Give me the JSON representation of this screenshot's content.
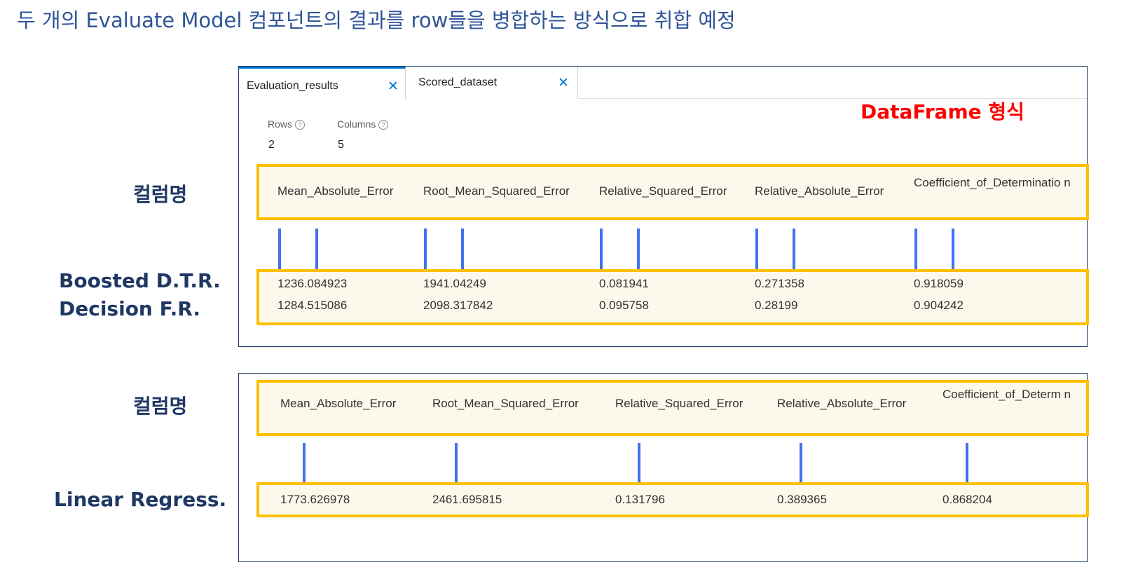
{
  "slide_title": "두 개의 Evaluate Model 컴포넌트의 결과를 row들을 병합하는 방식으로 취합 예정",
  "panel1": {
    "tabs": [
      {
        "label": "Evaluation_results",
        "close": "✕"
      },
      {
        "label": "Scored_dataset",
        "close": "✕"
      }
    ],
    "note": "DataFrame 형식",
    "rows_label": "Rows",
    "rows_value": "2",
    "columns_label": "Columns",
    "columns_value": "5",
    "help": "?",
    "columns": [
      "Mean_Absolute_Error",
      "Root_Mean_Squared_Error",
      "Relative_Squared_Error",
      "Relative_Absolute_Error",
      "Coefficient_of_Determinatio n"
    ],
    "rows": [
      [
        "1236.084923",
        "1941.04249",
        "0.081941",
        "0.271358",
        "0.918059"
      ],
      [
        "1284.515086",
        "2098.317842",
        "0.095758",
        "0.28199",
        "0.904242"
      ]
    ]
  },
  "panel2": {
    "columns": [
      "Mean_Absolute_Error",
      "Root_Mean_Squared_Error",
      "Relative_Squared_Error",
      "Relative_Absolute_Error",
      "Coefficient_of_Determ n"
    ],
    "rows": [
      [
        "1773.626978",
        "2461.695815",
        "0.131796",
        "0.389365",
        "0.868204"
      ]
    ]
  },
  "side_labels": {
    "column_name_1": "컬럼명",
    "row_label_1": "Boosted D.T.R.",
    "row_label_2": "Decision F.R.",
    "column_name_2": "컬럼명",
    "row_label_3": "Linear Regress."
  },
  "colors": {
    "accent": "#0078d4",
    "highlight_border": "#ffc000",
    "connector": "#4472ee",
    "note": "#ff0000",
    "label": "#1f3864"
  }
}
